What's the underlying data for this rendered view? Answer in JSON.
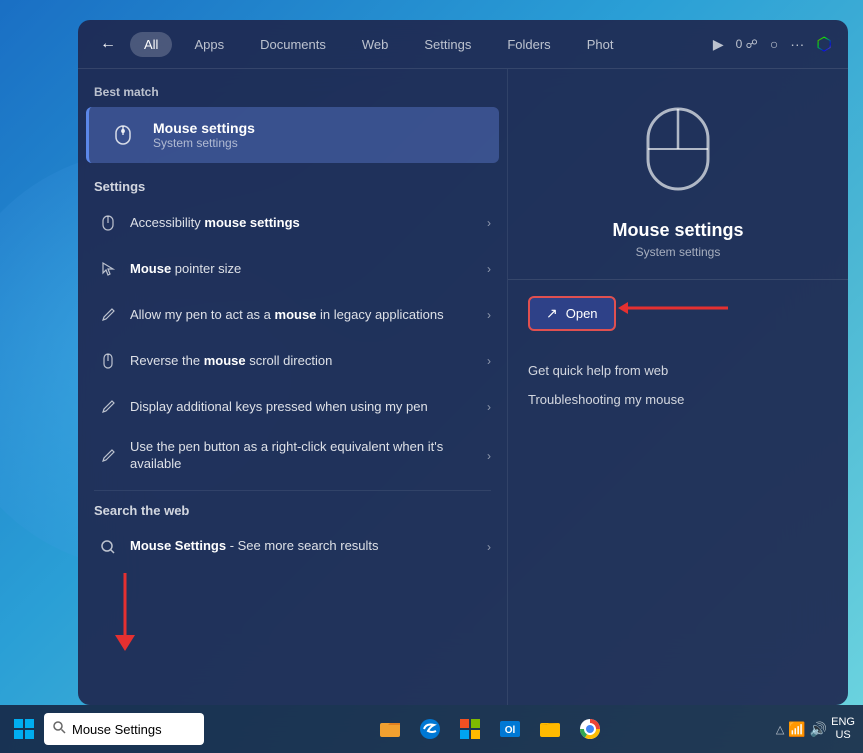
{
  "background": {
    "color_start": "#1a6fc4",
    "color_end": "#6dd5e0"
  },
  "search_popup": {
    "nav": {
      "back_label": "←",
      "tabs": [
        {
          "label": "All",
          "active": true
        },
        {
          "label": "Apps",
          "active": false
        },
        {
          "label": "Documents",
          "active": false
        },
        {
          "label": "Web",
          "active": false
        },
        {
          "label": "Settings",
          "active": false
        },
        {
          "label": "Folders",
          "active": false
        },
        {
          "label": "Phot",
          "active": false
        }
      ],
      "icons": [
        "▶",
        "0 ☍",
        "○",
        "···",
        "🎨"
      ]
    },
    "left": {
      "best_match_label": "Best match",
      "best_match": {
        "title": "Mouse settings",
        "subtitle": "System settings",
        "icon": "🖱"
      },
      "settings_label": "Settings",
      "items": [
        {
          "icon": "🖱",
          "text_html": "Accessibility <strong>mouse settings</strong>",
          "text_plain": "Accessibility mouse settings"
        },
        {
          "icon": "🐾",
          "text_html": "<strong>Mouse</strong> pointer size",
          "text_plain": "Mouse pointer size"
        },
        {
          "icon": "✒",
          "text_html": "Allow my pen to act as a <strong>mouse</strong> in legacy applications",
          "text_plain": "Allow my pen to act as a mouse in legacy applications"
        },
        {
          "icon": "🖱",
          "text_html": "Reverse the <strong>mouse</strong> scroll direction",
          "text_plain": "Reverse the mouse scroll direction"
        },
        {
          "icon": "✒",
          "text_html": "Display additional keys pressed when using my pen",
          "text_plain": "Display additional keys pressed when using my pen"
        },
        {
          "icon": "✒",
          "text_html": "Use the pen button as a right-click equivalent when it's available",
          "text_plain": "Use the pen button as a right-click equivalent when it's available"
        }
      ],
      "search_web_label": "Search the web",
      "web_items": [
        {
          "icon": "🔍",
          "text": "Mouse Settings",
          "subtext": " - See more search results"
        }
      ]
    },
    "right": {
      "title": "Mouse settings",
      "subtitle": "System settings",
      "open_label": "Open",
      "links": [
        "Get quick help from web",
        "Troubleshooting my mouse"
      ]
    }
  },
  "taskbar": {
    "search_placeholder": "Mouse Settings",
    "icons": [
      "📁",
      "🌐",
      "📧",
      "📁",
      "🔵"
    ],
    "time": "ENG\nUS",
    "system_icons": [
      "△",
      "📶",
      "🔊"
    ]
  }
}
